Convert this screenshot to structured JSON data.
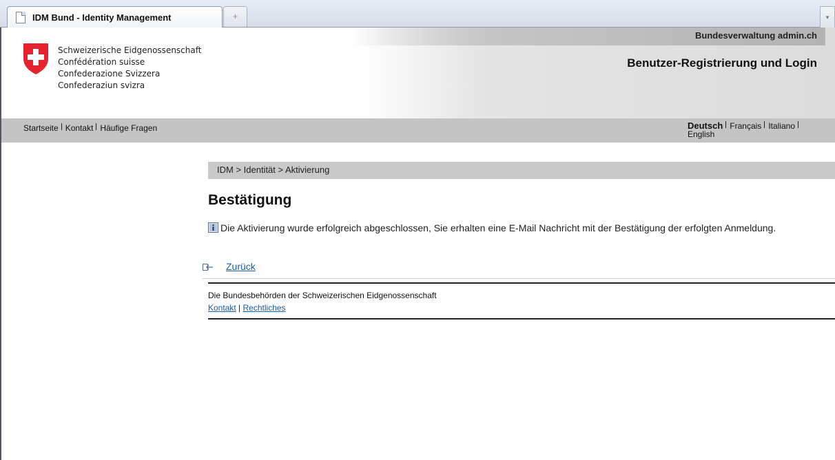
{
  "browser": {
    "tab_title": "IDM Bund - Identity Management",
    "new_tab_symbol": "+",
    "tab_list_symbol": "▾"
  },
  "header": {
    "admin_link": "Bundesverwaltung admin.ch",
    "confederation": [
      "Schweizerische Eidgenossenschaft",
      "Confédération suisse",
      "Confederazione Svizzera",
      "Confederaziun svizra"
    ],
    "page_heading": "Benutzer-Registrierung und Login"
  },
  "nav": {
    "items": [
      "Startseite",
      "Kontakt",
      "Häufige Fragen"
    ]
  },
  "languages": {
    "active": "Deutsch",
    "items": [
      "Français",
      "Italiano",
      "English"
    ]
  },
  "content": {
    "breadcrumb": "IDM > Identität > Aktivierung",
    "title": "Bestätigung",
    "message": "Die Aktivierung wurde erfolgreich abgeschlossen, Sie erhalten eine E-Mail Nachricht mit der Bestätigung der erfolgten Anmeldung.",
    "back_label": "Zurück"
  },
  "footer": {
    "text": "Die Bundesbehörden der Schweizerischen Eidgenossenschaft",
    "links": [
      "Kontakt",
      "Rechtliches"
    ],
    "separator": "|"
  },
  "colors": {
    "swiss_red": "#e8212e",
    "link_blue": "#1a5da8",
    "nav_gray": "#c4c4c4"
  }
}
